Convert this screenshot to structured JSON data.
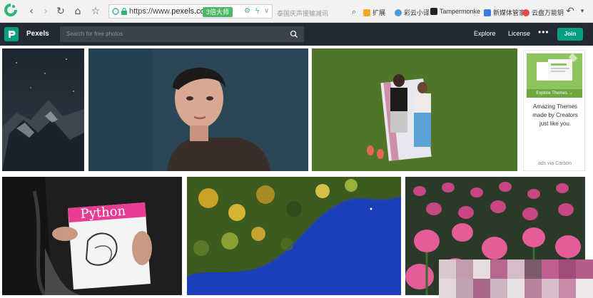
{
  "browser": {
    "url_scheme": "https://www.",
    "url_host": "pexels.co",
    "speed_badge": "3倍大师",
    "search_hint": "泰国庆声援输减讯",
    "bookmarks": [
      {
        "label": "扩展",
        "color": "#f5a623"
      },
      {
        "label": "彩云小译",
        "color": "#4a9ce8"
      },
      {
        "label": "Tampermonke",
        "color": "#222222"
      },
      {
        "label": "新媒体管家",
        "color": "#3b7be0"
      },
      {
        "label": "云盘万能钥",
        "color": "#e84a4a"
      }
    ]
  },
  "header": {
    "brand": "Pexels",
    "search_placeholder": "Search for free photos",
    "nav": {
      "explore": "Explore",
      "license": "License",
      "more": "•••",
      "join": "Join"
    }
  },
  "ad": {
    "thumb_label": "Explore Themes →",
    "text": "Amazing Themes made by Creators just like you.",
    "credit": "ads via Carbon"
  },
  "book": {
    "title": "Python"
  },
  "colors": {
    "accent": "#05a081",
    "header_bg": "#232a34"
  }
}
